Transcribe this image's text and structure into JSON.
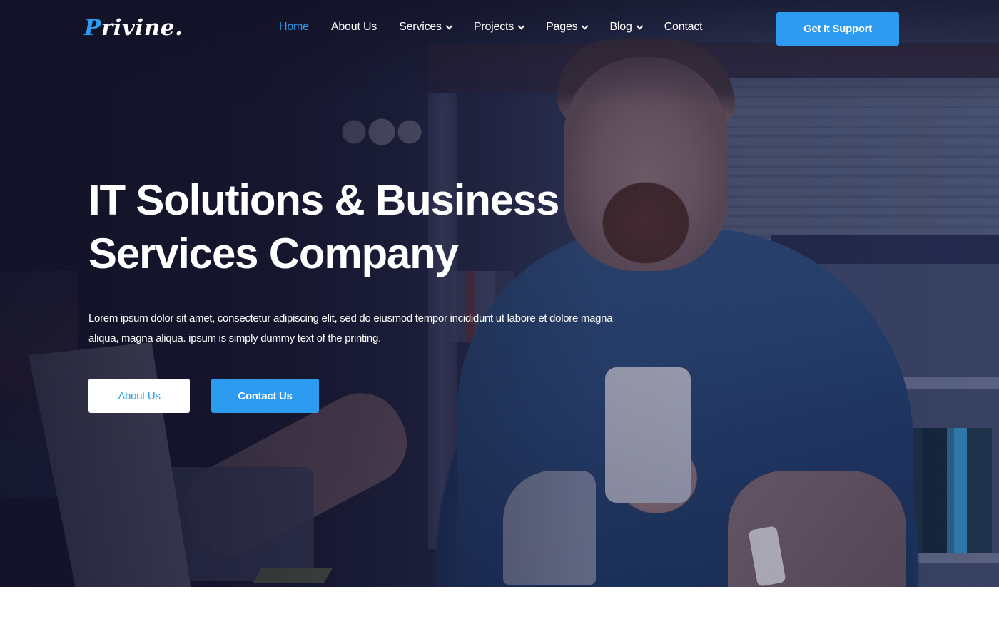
{
  "brand": {
    "logo_first_letter": "P",
    "logo_rest": "rivine.",
    "accent_color": "#2d9cf0"
  },
  "nav": {
    "items": [
      {
        "label": "Home",
        "active": true,
        "has_dropdown": false
      },
      {
        "label": "About Us",
        "active": false,
        "has_dropdown": false
      },
      {
        "label": "Services",
        "active": false,
        "has_dropdown": true
      },
      {
        "label": "Projects",
        "active": false,
        "has_dropdown": true
      },
      {
        "label": "Pages",
        "active": false,
        "has_dropdown": true
      },
      {
        "label": "Blog",
        "active": false,
        "has_dropdown": true
      },
      {
        "label": "Contact",
        "active": false,
        "has_dropdown": false
      }
    ],
    "dropdown_icon": "chevron-down-icon",
    "cta_label": "Get It Support"
  },
  "hero": {
    "title_line1": "IT Solutions & Business",
    "title_line2": "Services Company",
    "description": "Lorem ipsum dolor sit amet, consectetur adipiscing elit, sed do eiusmod tempor incididunt ut labore et dolore magna aliqua, magna aliqua. ipsum is simply dummy text of the printing.",
    "primary_button": "About Us",
    "secondary_button": "Contact Us",
    "background_image": "man-with-phone-and-laptop-photo",
    "overlay_color": "#15152c"
  },
  "colors": {
    "primary": "#2d9cf0",
    "text_light": "#ffffff",
    "button_white_bg": "#ffffff"
  }
}
